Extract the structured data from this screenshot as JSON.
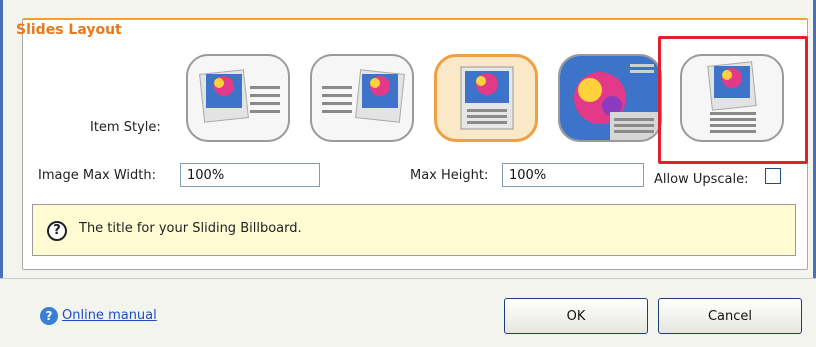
{
  "section": {
    "title": "Slides Layout"
  },
  "item_style": {
    "label": "Item Style:",
    "options": [
      {
        "name": "image-left-text-right",
        "selected": false
      },
      {
        "name": "text-left-image-right",
        "selected": false
      },
      {
        "name": "image-top-text-bottom",
        "selected": true
      },
      {
        "name": "full-image-text-overlay",
        "selected": false
      },
      {
        "name": "image-top-text-bottom-small",
        "selected": false
      }
    ]
  },
  "image_max_width": {
    "label": "Image Max Width:",
    "value": "100%"
  },
  "max_height": {
    "label": "Max Height:",
    "value": "100%"
  },
  "allow_upscale": {
    "label": "Allow Upscale:",
    "checked": false
  },
  "hint": {
    "icon": "question-icon",
    "text": "The title for your Sliding Billboard."
  },
  "footer": {
    "help_icon": "help-icon",
    "manual_link": "Online manual",
    "ok_label": "OK",
    "cancel_label": "Cancel"
  },
  "colors": {
    "accent": "#e8781e",
    "highlight": "#e0202a",
    "hint_bg": "#fffcd3"
  }
}
